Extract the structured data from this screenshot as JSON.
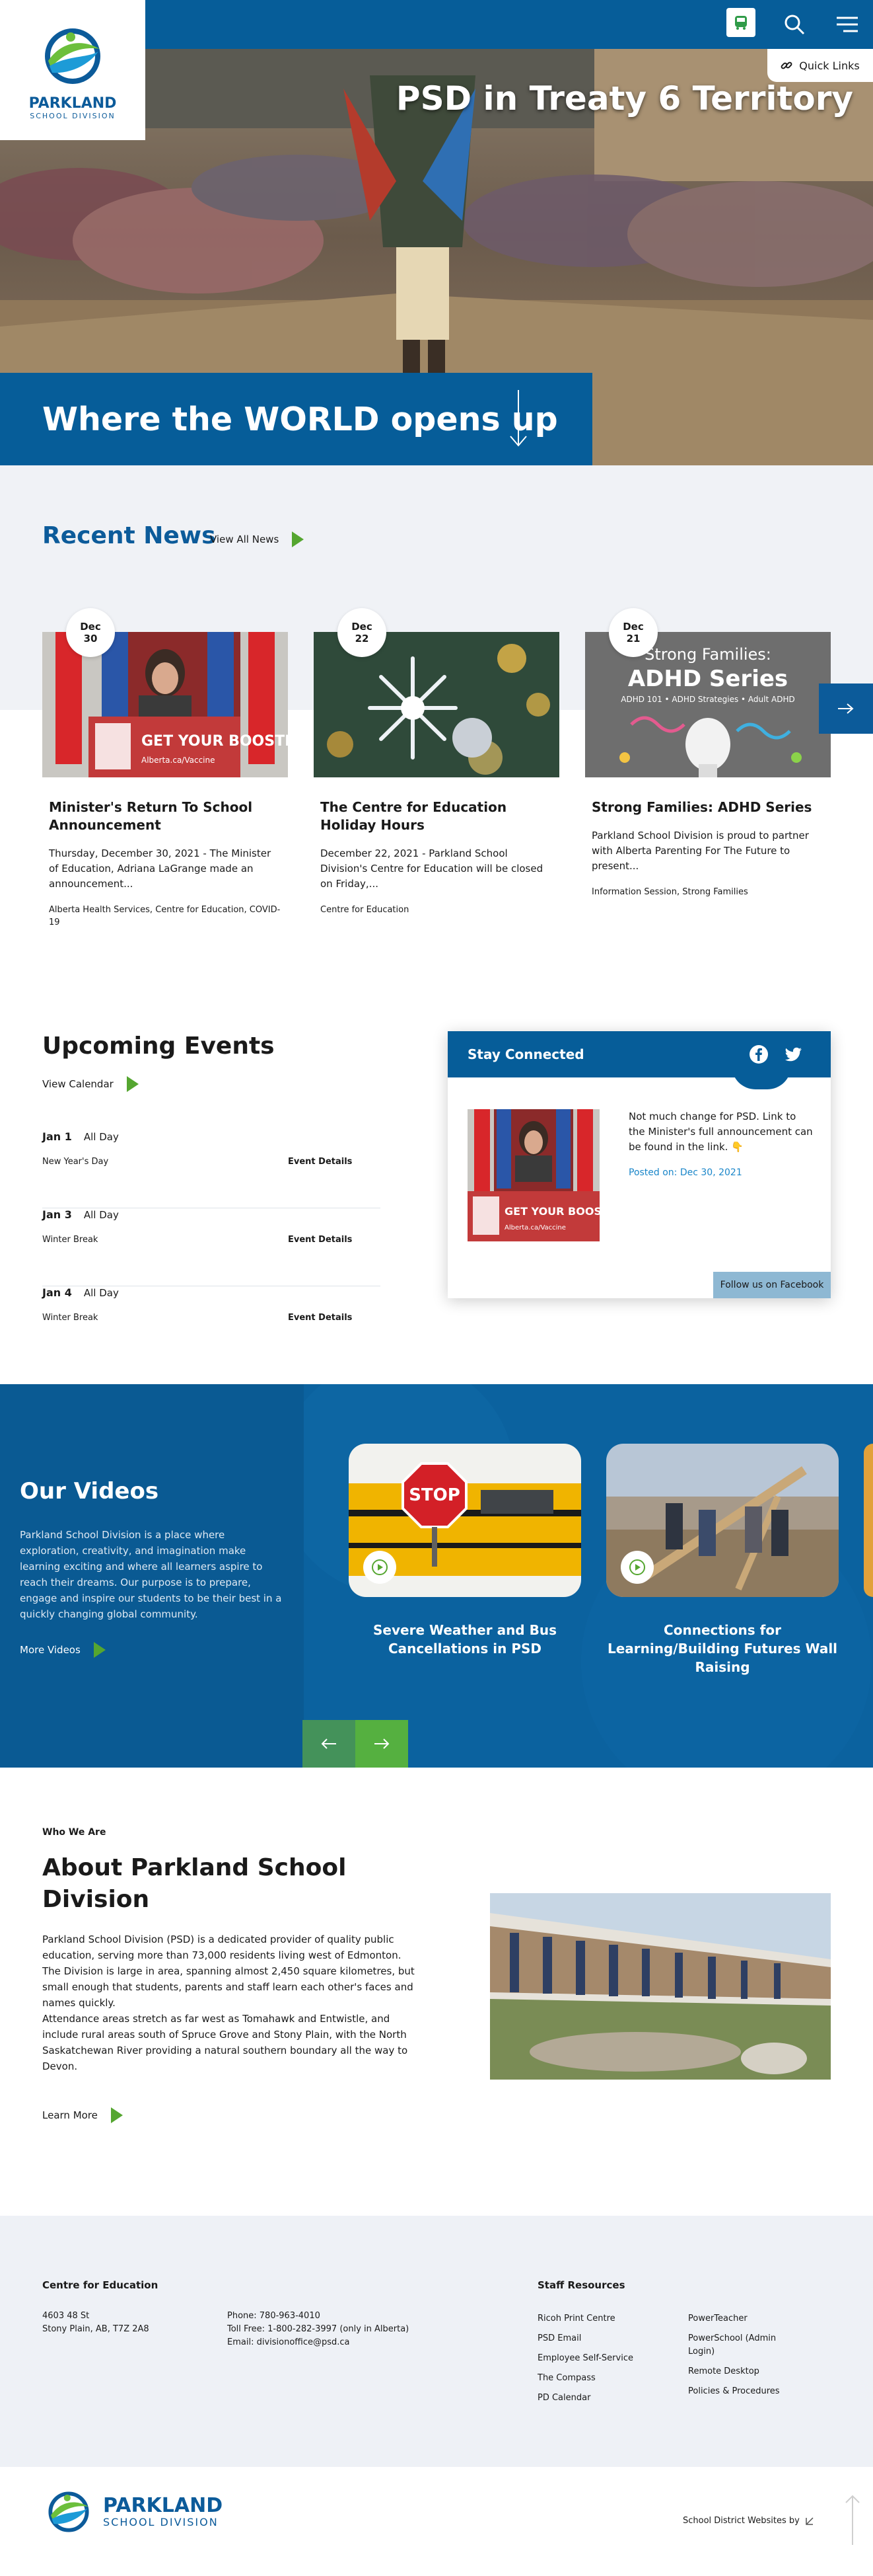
{
  "header": {
    "logo": {
      "name": "PARKLAND",
      "sub": "SCHOOL DIVISION"
    },
    "quick_links": "Quick Links",
    "icons": [
      "bus-icon",
      "search-icon",
      "menu-icon"
    ]
  },
  "hero": {
    "title": "PSD in Treaty 6 Territory",
    "tagline": "Where the WORLD opens up"
  },
  "news": {
    "heading": "Recent News",
    "view_all": "View All News",
    "items": [
      {
        "month": "Dec",
        "day": "30",
        "title": "Minister's Return To School Announcement",
        "text": "Thursday, December 30, 2021 - The Minister of Education, Adriana LaGrange made an announcement...",
        "tags": "Alberta Health Services, Centre for Education, COVID-19",
        "image_text": "GET YOUR BOOSTER.",
        "image_sub": "Alberta.ca/Vaccine"
      },
      {
        "month": "Dec",
        "day": "22",
        "title": "The Centre for Education Holiday Hours",
        "text": "December 22, 2021 - Parkland School Division's Centre for Education will be closed on Friday,...",
        "tags": "Centre for Education"
      },
      {
        "month": "Dec",
        "day": "21",
        "title": "Strong Families: ADHD Series",
        "text": "Parkland School Division is proud to partner with Alberta Parenting For The Future to present...",
        "tags": "Information Session, Strong Families",
        "image_text": "Strong Families:",
        "image_big": "ADHD Series",
        "image_sub": "ADHD 101 • ADHD Strategies • Adult ADHD"
      }
    ]
  },
  "events": {
    "heading": "Upcoming Events",
    "view_calendar": "View Calendar",
    "items": [
      {
        "date": "Jan 1",
        "time": "All Day",
        "name": "New Year's Day",
        "link": "Event Details"
      },
      {
        "date": "Jan 3",
        "time": "All Day",
        "name": "Winter Break",
        "link": "Event Details"
      },
      {
        "date": "Jan 4",
        "time": "All Day",
        "name": "Winter Break",
        "link": "Event Details"
      }
    ]
  },
  "stay_connected": {
    "heading": "Stay Connected",
    "post_text": "Not much change for PSD. Link to the Minister's full announcement can be found in the link. 👇",
    "posted_on": "Posted on: Dec 30, 2021",
    "follow": "Follow us on Facebook",
    "image_text": "GET YOUR BOOSTER.",
    "image_sub": "Alberta.ca/Vaccine"
  },
  "videos": {
    "heading": "Our Videos",
    "text": "Parkland School Division is a place where exploration, creativity, and imagination make learning exciting and where all learners aspire to reach their dreams. Our purpose is to prepare, engage and inspire our students to be their best in a quickly changing global community.",
    "more": "More Videos",
    "items": [
      {
        "title": "Severe Weather and Bus Cancellations in PSD",
        "sign": "STOP"
      },
      {
        "title": "Connections for Learning/Building Futures Wall Raising"
      }
    ]
  },
  "about": {
    "eyebrow": "Who We Are",
    "heading": "About Parkland School Division",
    "p1": "Parkland School Division (PSD) is a dedicated provider of quality public education, serving more than 73,000 residents living west of Edmonton. The Division is large in area, spanning almost 2,450 square kilometres, but small enough that students, parents and staff learn each other's faces and names quickly.",
    "p2": "Attendance areas stretch as far west as Tomahawk and Entwistle, and include rural areas south of Spruce Grove and Stony Plain, with the North Saskatchewan River providing a natural southern boundary all the way to Devon.",
    "learn_more": "Learn More"
  },
  "footer": {
    "centre_heading": "Centre for Education",
    "address1": "4603 48 St",
    "address2": "Stony Plain, AB, T7Z 2A8",
    "phone": "Phone: 780-963-4010",
    "tollfree": "Toll Free: 1-800-282-3997 (only in Alberta)",
    "email": "Email: divisionoffice@psd.ca",
    "staff_heading": "Staff Resources",
    "links_col1": [
      "Ricoh Print Centre",
      "PSD Email",
      "Employee Self-Service",
      "The Compass",
      "PD Calendar"
    ],
    "links_col2": [
      "PowerTeacher",
      "PowerSchool (Admin Login)",
      "Remote Desktop",
      "Policies & Procedures"
    ],
    "credit": "School District Websites by"
  },
  "colors": {
    "brand_blue": "#065d99",
    "accent_green": "#55a630",
    "link_blue": "#1a86c9"
  }
}
